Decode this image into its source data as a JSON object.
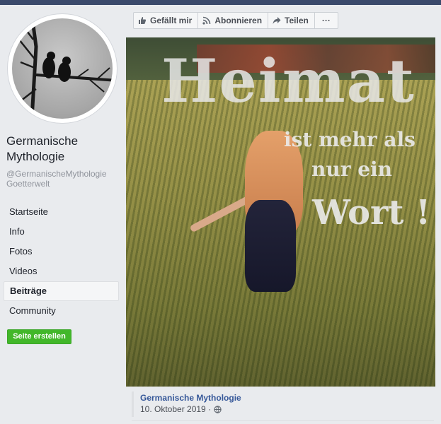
{
  "page": {
    "title": "Germanische Mythologie",
    "handle": "@GermanischeMythologieGoetterwelt",
    "handle_line1": "@GermanischeMythologie",
    "handle_line2": "Goetterwelt"
  },
  "nav": {
    "items": [
      {
        "label": "Startseite",
        "active": false
      },
      {
        "label": "Info",
        "active": false
      },
      {
        "label": "Fotos",
        "active": false
      },
      {
        "label": "Videos",
        "active": false
      },
      {
        "label": "Beiträge",
        "active": true
      },
      {
        "label": "Community",
        "active": false
      }
    ]
  },
  "create_page_button": "Seite erstellen",
  "actions": {
    "like": "Gefällt mir",
    "subscribe": "Abonnieren",
    "share": "Teilen",
    "more": "···"
  },
  "post": {
    "image_text": {
      "line1": "Heimat",
      "line2": "ist mehr als",
      "line3": "nur ein",
      "line4": "Wort !"
    },
    "author": "Germanische Mythologie",
    "date": "10. Oktober 2019 ·"
  },
  "icons": {
    "like": "thumbs-up-icon",
    "subscribe": "rss-icon",
    "share": "share-arrow-icon",
    "more": "more-dots-icon",
    "audience": "globe-icon"
  },
  "colors": {
    "link": "#365899",
    "create_button": "#42b72a",
    "top_bar": "#3b4a6b"
  }
}
